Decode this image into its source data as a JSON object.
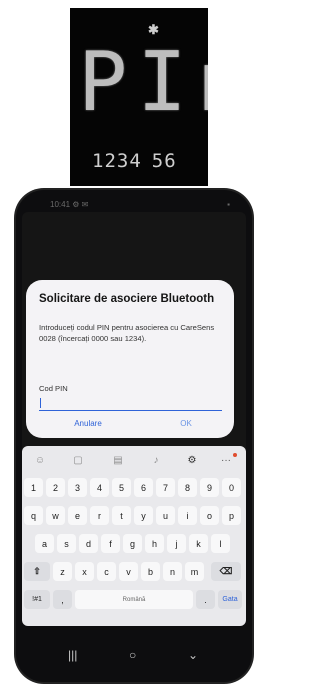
{
  "meter": {
    "bluetooth_symbol": "✱",
    "main_display": "PIn",
    "pin_digits": [
      "1234",
      "56"
    ]
  },
  "status": {
    "left": "10:41 ⚙ ✉",
    "right": "▪"
  },
  "dialog": {
    "title": "Solicitare de asociere Bluetooth",
    "message": "Introduceți codul PIN pentru asocierea cu CareSens 0028 (încercați 0000 sau 1234).",
    "input_label": "Cod PIN",
    "input_value": "",
    "cancel": "Anulare",
    "ok": "OK"
  },
  "keyboard": {
    "toolbar": [
      "☺",
      "▢",
      "▤",
      "♪",
      "⚙",
      "···"
    ],
    "rows": [
      [
        "1",
        "2",
        "3",
        "4",
        "5",
        "6",
        "7",
        "8",
        "9",
        "0"
      ],
      [
        "q",
        "w",
        "e",
        "r",
        "t",
        "y",
        "u",
        "i",
        "o",
        "p"
      ],
      [
        "a",
        "s",
        "d",
        "f",
        "g",
        "h",
        "j",
        "k",
        "l"
      ],
      [
        "⇧",
        "z",
        "x",
        "c",
        "v",
        "b",
        "n",
        "m",
        "⌫"
      ],
      [
        "!#1",
        ",",
        "Română",
        ".",
        "Gata"
      ]
    ]
  },
  "nav": {
    "recents": "|||",
    "home": "○",
    "back": "⌄"
  },
  "colors": {
    "accent": "#2f63d8",
    "dialog_bg": "#f4f3f6",
    "keyboard_bg": "#e9e9ec",
    "meter_bg": "#050505"
  }
}
